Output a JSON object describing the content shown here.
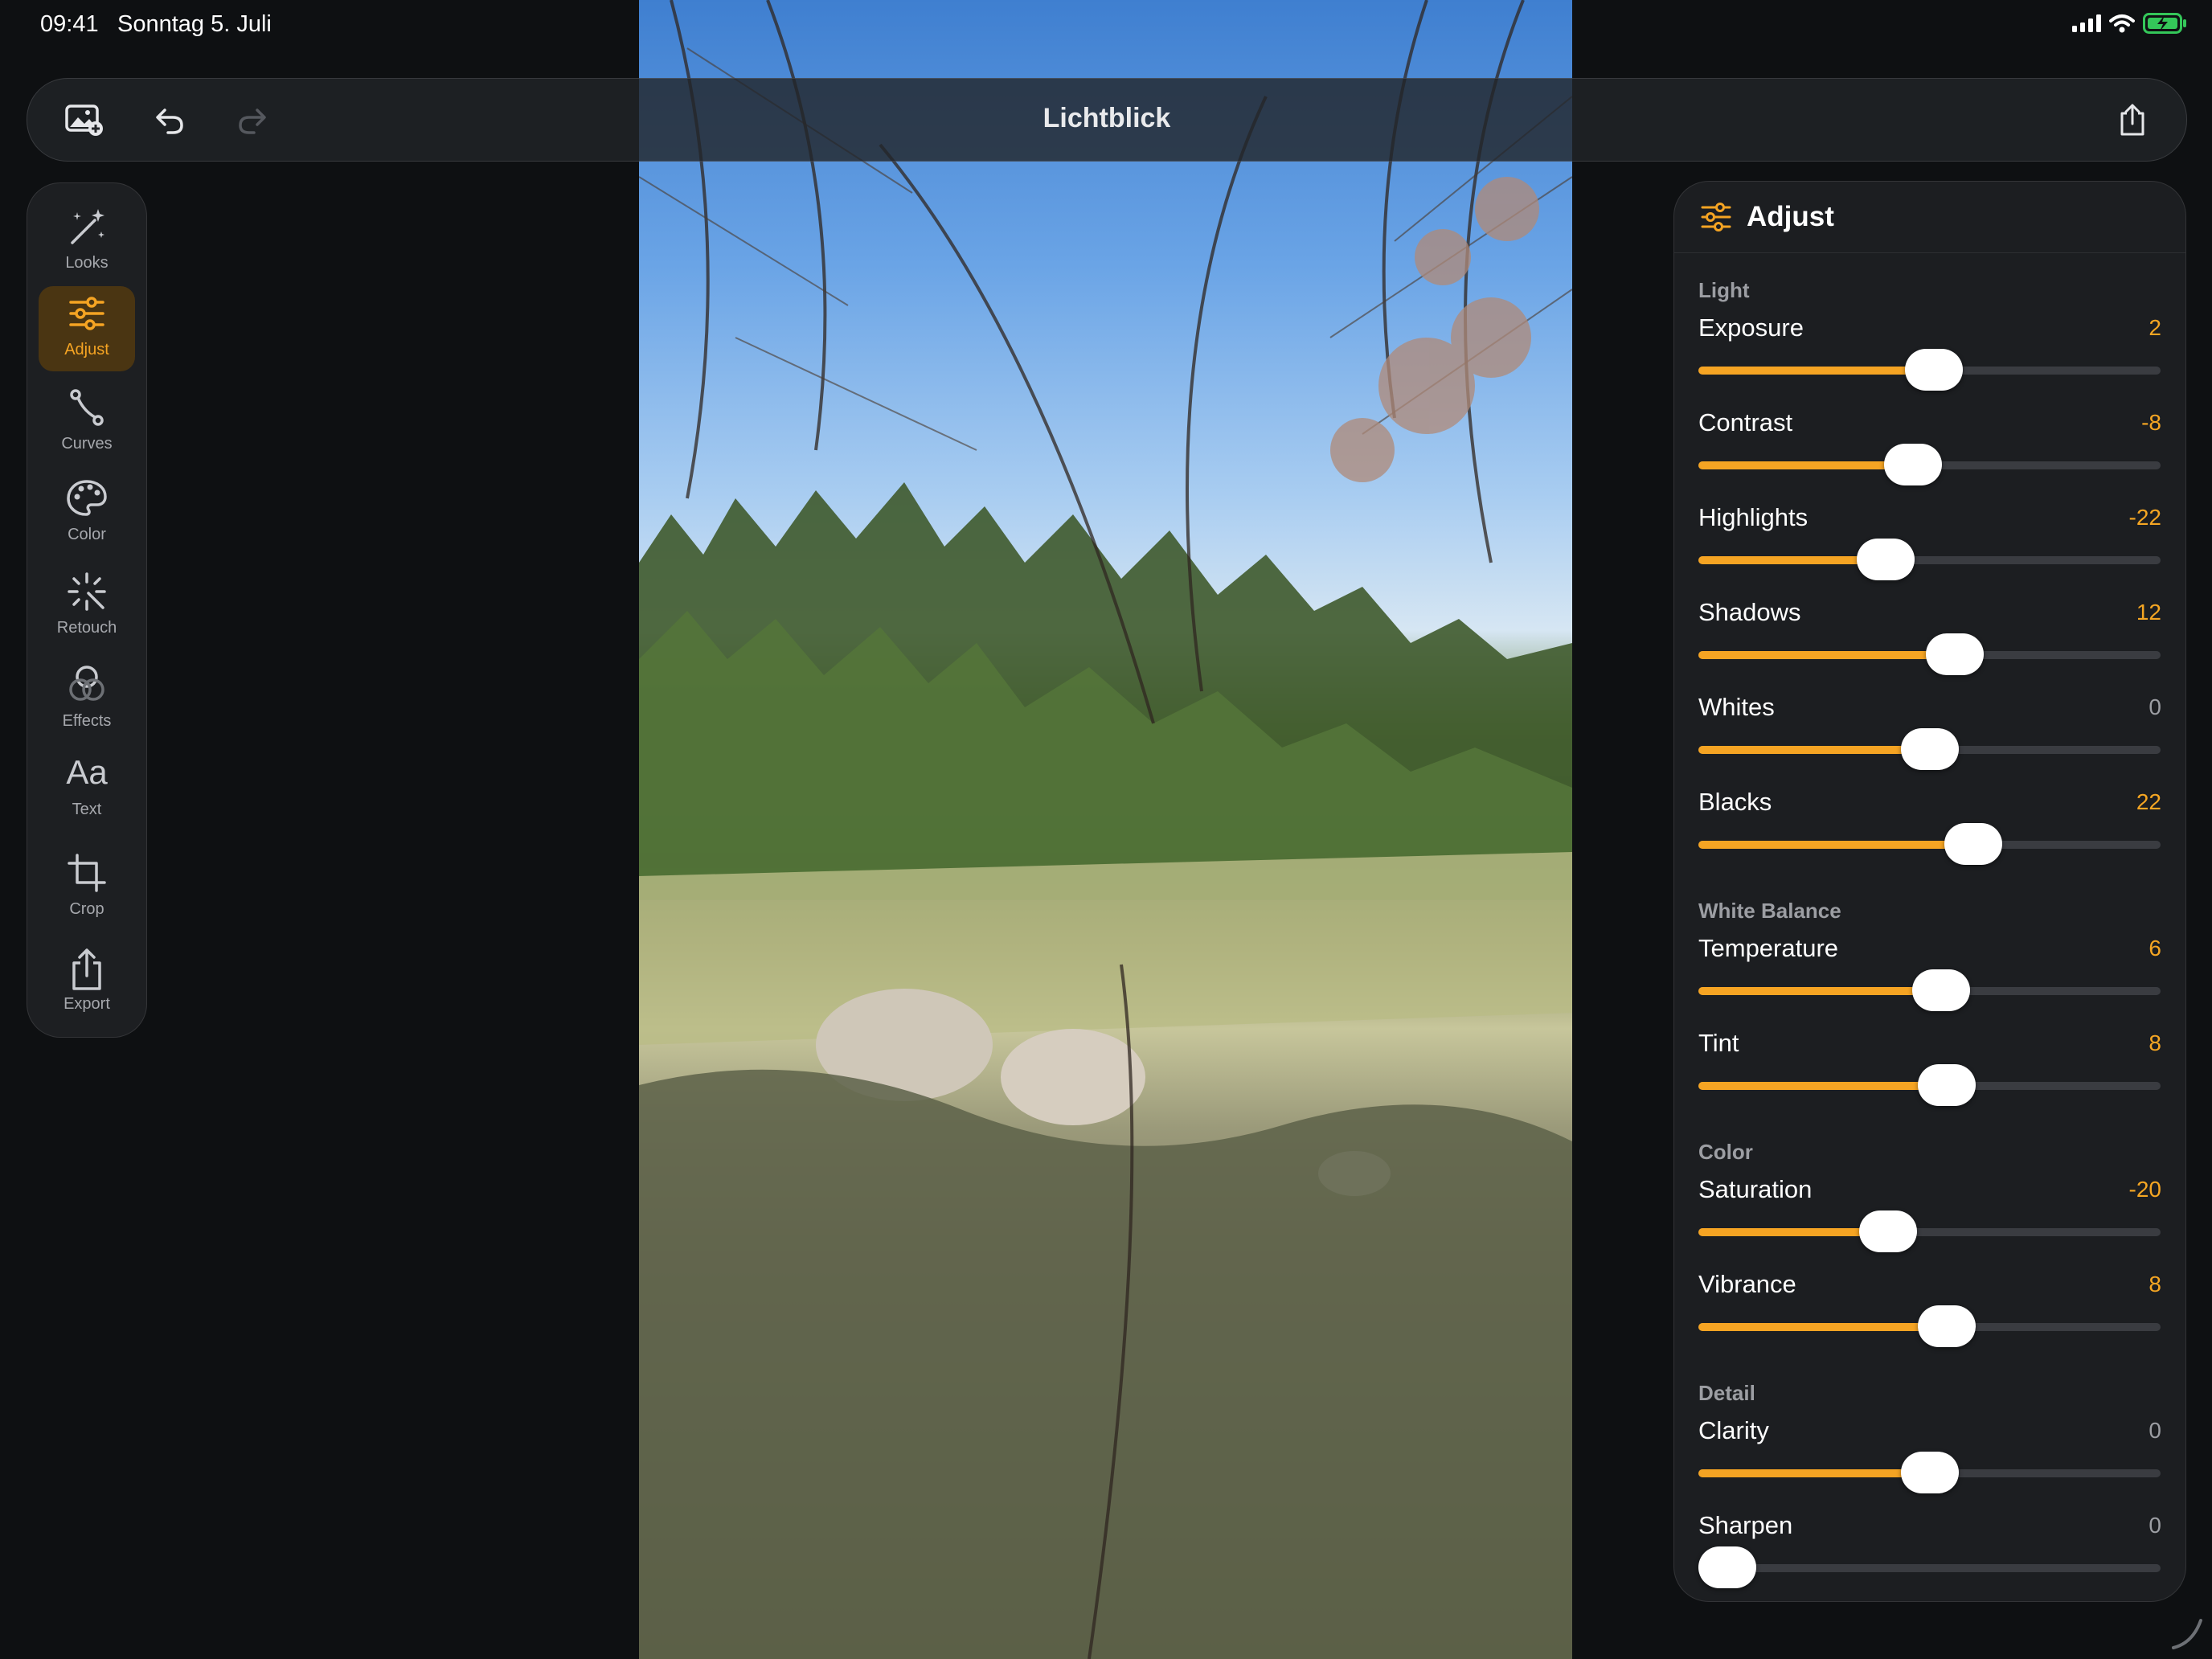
{
  "status": {
    "time": "09:41",
    "date": "Sonntag 5. Juli"
  },
  "toolbar": {
    "title": "Lichtblick"
  },
  "rail": [
    {
      "id": "looks",
      "label": "Looks",
      "icon": "magic-wand-icon",
      "active": false
    },
    {
      "id": "adjust",
      "label": "Adjust",
      "icon": "sliders-icon",
      "active": true
    },
    {
      "id": "curves",
      "label": "Curves",
      "icon": "curves-icon",
      "active": false
    },
    {
      "id": "color",
      "label": "Color",
      "icon": "palette-icon",
      "active": false
    },
    {
      "id": "retouch",
      "label": "Retouch",
      "icon": "sparkle-wand-icon",
      "active": false
    },
    {
      "id": "effects",
      "label": "Effects",
      "icon": "overlapping-circles-icon",
      "active": false
    },
    {
      "id": "text",
      "label": "Text",
      "icon": "text-aa-icon",
      "active": false
    },
    {
      "id": "crop",
      "label": "Crop",
      "icon": "crop-icon",
      "active": false
    },
    {
      "id": "export",
      "label": "Export",
      "icon": "share-icon",
      "active": false
    }
  ],
  "panel": {
    "title": "Adjust",
    "sections": [
      {
        "title": "Light",
        "items": [
          {
            "label": "Exposure",
            "value": "2",
            "level": 0.51
          },
          {
            "label": "Contrast",
            "value": "-8",
            "level": 0.465
          },
          {
            "label": "Highlights",
            "value": "-22",
            "level": 0.405
          },
          {
            "label": "Shadows",
            "value": "12",
            "level": 0.555
          },
          {
            "label": "Whites",
            "value": "0",
            "level": 0.5
          },
          {
            "label": "Blacks",
            "value": "22",
            "level": 0.595
          }
        ]
      },
      {
        "title": "White Balance",
        "items": [
          {
            "label": "Temperature",
            "value": "6",
            "level": 0.525
          },
          {
            "label": "Tint",
            "value": "8",
            "level": 0.537
          }
        ]
      },
      {
        "title": "Color",
        "items": [
          {
            "label": "Saturation",
            "value": "-20",
            "level": 0.41
          },
          {
            "label": "Vibrance",
            "value": "8",
            "level": 0.537
          }
        ]
      },
      {
        "title": "Detail",
        "items": [
          {
            "label": "Clarity",
            "value": "0",
            "level": 0.5
          },
          {
            "label": "Sharpen",
            "value": "0",
            "level": 0.0
          }
        ]
      }
    ]
  }
}
